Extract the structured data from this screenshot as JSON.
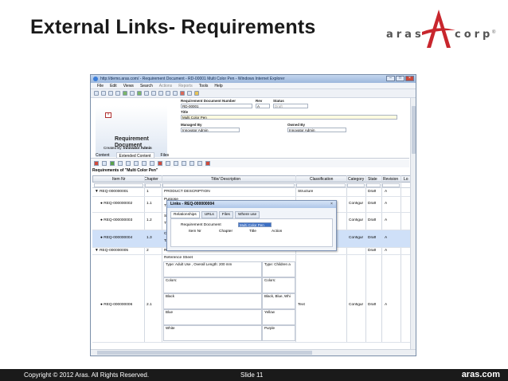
{
  "slide": {
    "title": "External Links- Requirements",
    "logo_left": "aras",
    "logo_right": "corp",
    "logo_reg": "®",
    "footer_copyright": "Copyright © 2012 Aras.  All Rights Reserved.",
    "footer_slide": "Slide 11",
    "footer_brand": "aras.com",
    "colors": {
      "title": "#1a1a1a",
      "footer_bg": "#1a1a1a",
      "logo_red": "#c8262d"
    }
  },
  "window": {
    "title": "http://demo.aras.com/ - Requirement Document - RD-00001 Multi Color Pen - Windows Internet Explorer",
    "menu": [
      "File",
      "Edit",
      "Views",
      "Search",
      "Actions",
      "Reports",
      "Tools",
      "Help"
    ],
    "menu_dim": [
      "Actions",
      "Reports"
    ]
  },
  "form": {
    "logo_text": "Requirement Document",
    "created_by_label": "Created By:",
    "created_by_value": "Innovator Admin",
    "number_label": "Requirement Document Number",
    "number_value": "RD-00001",
    "rev_label": "Rev",
    "rev_value": "A",
    "status_label": "Status",
    "status_value": "Draft",
    "title_label": "Title",
    "title_value": "Multi Color Pen",
    "managed_label": "Managed By",
    "managed_value": "Innovator Admin",
    "owned_label": "Owned By",
    "owned_value": "Innovator Admin"
  },
  "tabs": [
    "Content",
    "Extended Content",
    "Files"
  ],
  "grid": {
    "caption": "Requirements of \"Multi Color Pen\"",
    "columns": [
      "Item Nr",
      "Chapter",
      "Title/ Description",
      "Classification",
      "Category",
      "State",
      "Revision",
      "Lo"
    ],
    "rows": [
      {
        "item": "▼ REQ-000000001",
        "chapter": "1",
        "title": "PRODUCT DESCRIPTION",
        "class": "Structure",
        "cat": "",
        "state": "Draft",
        "rev": "A"
      },
      {
        "item": "● REQ-000000002",
        "chapter": "1.1",
        "title": "Purpose",
        "title2": "Th",
        "class": "",
        "cat": "Configur",
        "state": "Draft",
        "rev": "A"
      },
      {
        "item": "● REQ-000000003",
        "chapter": "1.2",
        "title": "Sc",
        "title2": "Th",
        "class": "",
        "cat": "Configur",
        "state": "Draft",
        "rev": "A"
      },
      {
        "item": "● REQ-000000004",
        "chapter": "1.3",
        "title": "Ch",
        "title2": "Ta",
        "class": "",
        "cat": "Configur",
        "state": "Draft",
        "rev": "A"
      },
      {
        "item": "▼ REQ-000000005",
        "chapter": "2",
        "title": "R",
        "class": "",
        "cat": "",
        "state": "Draft",
        "rev": "A"
      },
      {
        "item": "● REQ-000000006",
        "chapter": "2.1",
        "title": "Reference Sheet",
        "class": "Text",
        "cat": "Configur",
        "state": "Draft",
        "rev": "A"
      }
    ],
    "sheet": [
      [
        "Type: Adult Use ,  Overall Length: 200 mm",
        "Type: Children a"
      ],
      [
        "Colors:",
        "Colors:"
      ],
      [
        "Black",
        "Black, Blue, Whi"
      ],
      [
        "Blue",
        "Yellow"
      ],
      [
        "White",
        "Purple"
      ]
    ]
  },
  "popup": {
    "title": "Links - REQ-000000004",
    "close": "×",
    "tabs": [
      "Relationships",
      "URLs",
      "Files",
      "Where use"
    ],
    "doc_label": "Requirement Document",
    "doc_value": "Multi Color Pen",
    "cols": [
      "Item Nr",
      "Chapter",
      "Title",
      "Action"
    ]
  }
}
